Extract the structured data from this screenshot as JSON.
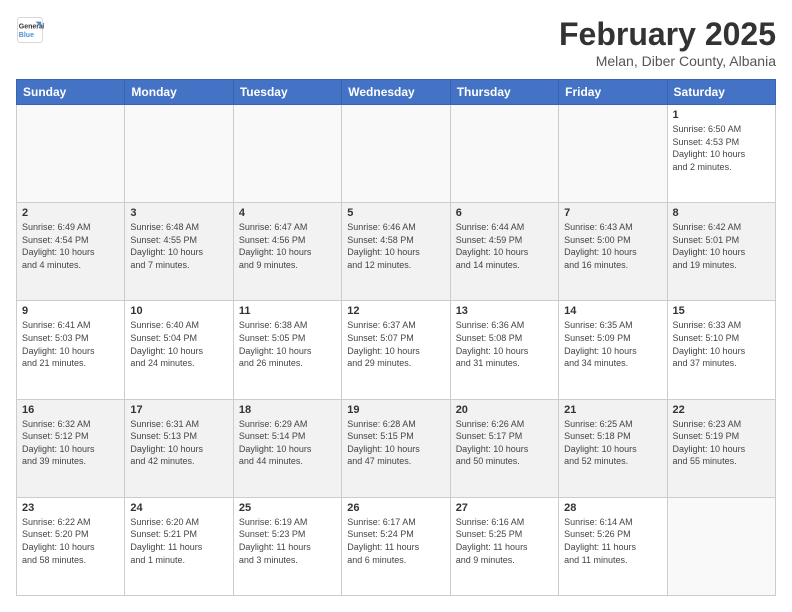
{
  "header": {
    "logo_general": "General",
    "logo_blue": "Blue",
    "month_title": "February 2025",
    "location": "Melan, Diber County, Albania"
  },
  "days_of_week": [
    "Sunday",
    "Monday",
    "Tuesday",
    "Wednesday",
    "Thursday",
    "Friday",
    "Saturday"
  ],
  "weeks": [
    [
      {
        "day": "",
        "info": ""
      },
      {
        "day": "",
        "info": ""
      },
      {
        "day": "",
        "info": ""
      },
      {
        "day": "",
        "info": ""
      },
      {
        "day": "",
        "info": ""
      },
      {
        "day": "",
        "info": ""
      },
      {
        "day": "1",
        "info": "Sunrise: 6:50 AM\nSunset: 4:53 PM\nDaylight: 10 hours\nand 2 minutes."
      }
    ],
    [
      {
        "day": "2",
        "info": "Sunrise: 6:49 AM\nSunset: 4:54 PM\nDaylight: 10 hours\nand 4 minutes."
      },
      {
        "day": "3",
        "info": "Sunrise: 6:48 AM\nSunset: 4:55 PM\nDaylight: 10 hours\nand 7 minutes."
      },
      {
        "day": "4",
        "info": "Sunrise: 6:47 AM\nSunset: 4:56 PM\nDaylight: 10 hours\nand 9 minutes."
      },
      {
        "day": "5",
        "info": "Sunrise: 6:46 AM\nSunset: 4:58 PM\nDaylight: 10 hours\nand 12 minutes."
      },
      {
        "day": "6",
        "info": "Sunrise: 6:44 AM\nSunset: 4:59 PM\nDaylight: 10 hours\nand 14 minutes."
      },
      {
        "day": "7",
        "info": "Sunrise: 6:43 AM\nSunset: 5:00 PM\nDaylight: 10 hours\nand 16 minutes."
      },
      {
        "day": "8",
        "info": "Sunrise: 6:42 AM\nSunset: 5:01 PM\nDaylight: 10 hours\nand 19 minutes."
      }
    ],
    [
      {
        "day": "9",
        "info": "Sunrise: 6:41 AM\nSunset: 5:03 PM\nDaylight: 10 hours\nand 21 minutes."
      },
      {
        "day": "10",
        "info": "Sunrise: 6:40 AM\nSunset: 5:04 PM\nDaylight: 10 hours\nand 24 minutes."
      },
      {
        "day": "11",
        "info": "Sunrise: 6:38 AM\nSunset: 5:05 PM\nDaylight: 10 hours\nand 26 minutes."
      },
      {
        "day": "12",
        "info": "Sunrise: 6:37 AM\nSunset: 5:07 PM\nDaylight: 10 hours\nand 29 minutes."
      },
      {
        "day": "13",
        "info": "Sunrise: 6:36 AM\nSunset: 5:08 PM\nDaylight: 10 hours\nand 31 minutes."
      },
      {
        "day": "14",
        "info": "Sunrise: 6:35 AM\nSunset: 5:09 PM\nDaylight: 10 hours\nand 34 minutes."
      },
      {
        "day": "15",
        "info": "Sunrise: 6:33 AM\nSunset: 5:10 PM\nDaylight: 10 hours\nand 37 minutes."
      }
    ],
    [
      {
        "day": "16",
        "info": "Sunrise: 6:32 AM\nSunset: 5:12 PM\nDaylight: 10 hours\nand 39 minutes."
      },
      {
        "day": "17",
        "info": "Sunrise: 6:31 AM\nSunset: 5:13 PM\nDaylight: 10 hours\nand 42 minutes."
      },
      {
        "day": "18",
        "info": "Sunrise: 6:29 AM\nSunset: 5:14 PM\nDaylight: 10 hours\nand 44 minutes."
      },
      {
        "day": "19",
        "info": "Sunrise: 6:28 AM\nSunset: 5:15 PM\nDaylight: 10 hours\nand 47 minutes."
      },
      {
        "day": "20",
        "info": "Sunrise: 6:26 AM\nSunset: 5:17 PM\nDaylight: 10 hours\nand 50 minutes."
      },
      {
        "day": "21",
        "info": "Sunrise: 6:25 AM\nSunset: 5:18 PM\nDaylight: 10 hours\nand 52 minutes."
      },
      {
        "day": "22",
        "info": "Sunrise: 6:23 AM\nSunset: 5:19 PM\nDaylight: 10 hours\nand 55 minutes."
      }
    ],
    [
      {
        "day": "23",
        "info": "Sunrise: 6:22 AM\nSunset: 5:20 PM\nDaylight: 10 hours\nand 58 minutes."
      },
      {
        "day": "24",
        "info": "Sunrise: 6:20 AM\nSunset: 5:21 PM\nDaylight: 11 hours\nand 1 minute."
      },
      {
        "day": "25",
        "info": "Sunrise: 6:19 AM\nSunset: 5:23 PM\nDaylight: 11 hours\nand 3 minutes."
      },
      {
        "day": "26",
        "info": "Sunrise: 6:17 AM\nSunset: 5:24 PM\nDaylight: 11 hours\nand 6 minutes."
      },
      {
        "day": "27",
        "info": "Sunrise: 6:16 AM\nSunset: 5:25 PM\nDaylight: 11 hours\nand 9 minutes."
      },
      {
        "day": "28",
        "info": "Sunrise: 6:14 AM\nSunset: 5:26 PM\nDaylight: 11 hours\nand 11 minutes."
      },
      {
        "day": "",
        "info": ""
      }
    ]
  ]
}
